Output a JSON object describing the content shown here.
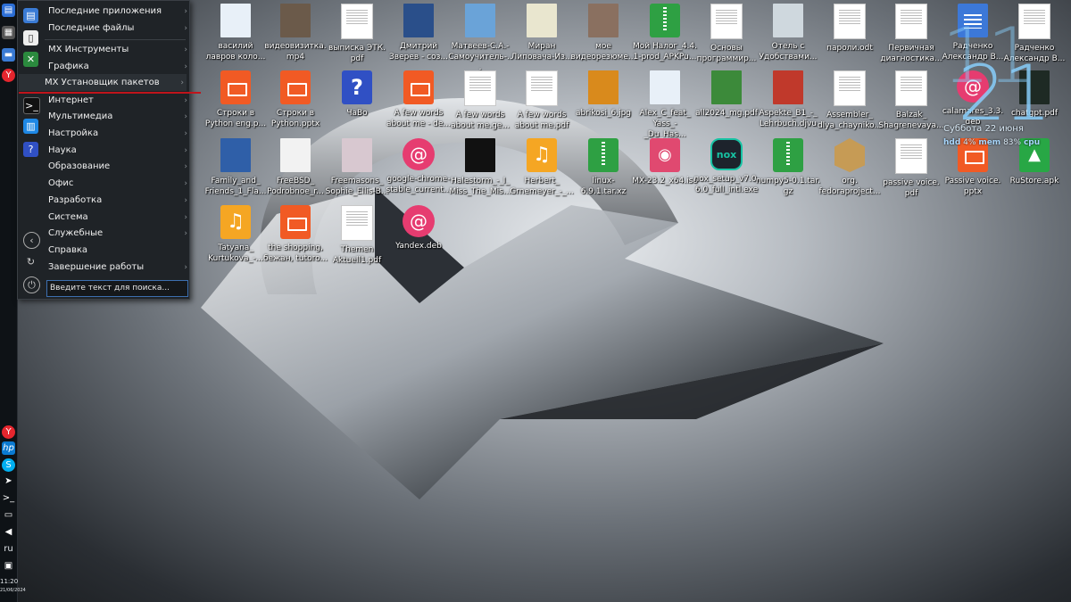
{
  "menu": {
    "items": [
      {
        "label": "Последние приложения",
        "icon": "recent-apps-icon"
      },
      {
        "label": "Последние файлы",
        "icon": "recent-files-icon"
      },
      {
        "label": "MX Инструменты",
        "icon": "mx-tools-icon"
      },
      {
        "label": "Графика",
        "icon": "graphics-icon"
      },
      {
        "label": "MX Установщик пакетов",
        "icon": "package-installer-icon"
      },
      {
        "label": "Интернет",
        "icon": "internet-icon"
      },
      {
        "label": "Мультимедиа",
        "icon": "multimedia-icon"
      },
      {
        "label": "Настройка",
        "icon": "settings-icon"
      },
      {
        "label": "Наука",
        "icon": "science-icon"
      },
      {
        "label": "Образование",
        "icon": "education-icon"
      },
      {
        "label": "Офис",
        "icon": "office-icon"
      },
      {
        "label": "Разработка",
        "icon": "development-icon"
      },
      {
        "label": "Система",
        "icon": "system-icon"
      },
      {
        "label": "Служебные",
        "icon": "utilities-icon"
      },
      {
        "label": "Справка",
        "icon": "help-icon"
      },
      {
        "label": "Завершение работы",
        "icon": "shutdown-icon"
      }
    ],
    "arrow": "›",
    "search_placeholder": "Введите текст для поиска..."
  },
  "taskbar": {
    "layout": "ru",
    "time": "11:20",
    "date": "21/06/2024"
  },
  "desktop": {
    "icons": [
      {
        "label": "василий лавров коло...",
        "kind": "pic",
        "color": "#e8f0f8"
      },
      {
        "label": "видеовизитка. mp4",
        "kind": "pic",
        "color": "#6b5a4a"
      },
      {
        "label": "выписка ЭТК. pdf",
        "kind": "doc"
      },
      {
        "label": "Дмитрий Зверев - соз...",
        "kind": "pic",
        "color": "#2a4f8a"
      },
      {
        "label": "Матвеев-С.А.- Самоучитель-...",
        "kind": "pic",
        "color": "#6aa3d8"
      },
      {
        "label": "Миран Липовача-Из...",
        "kind": "pic",
        "color": "#e9e6cf"
      },
      {
        "label": "мое видеорезюме...",
        "kind": "pic",
        "color": "#8a7060"
      },
      {
        "label": "Мой Налог_4.4. 1-prod_APKPu...",
        "kind": "zip"
      },
      {
        "label": "Основы программир...",
        "kind": "doc"
      },
      {
        "label": "Отель с Удобствами...",
        "kind": "pic",
        "color": "#cfd8de"
      },
      {
        "label": "пароли.odt",
        "kind": "doc"
      },
      {
        "label": "Первичная диагностика...",
        "kind": "doc"
      },
      {
        "label": "Радченко Александр В...",
        "kind": "gdoc"
      },
      {
        "label": "Радченко Александр В...",
        "kind": "doc"
      },
      {
        "label": "Строки в Python eng.p...",
        "kind": "pres"
      },
      {
        "label": "Строки в Python.pptx",
        "kind": "pres"
      },
      {
        "label": "ЧаВо",
        "kind": "question"
      },
      {
        "label": "A few words about me - de...",
        "kind": "pres"
      },
      {
        "label": "A few words about me.ge...",
        "kind": "doc"
      },
      {
        "label": "A few words about me.pdf",
        "kind": "doc"
      },
      {
        "label": "abrikosi_6.jpg",
        "kind": "pic",
        "color": "#d98a1c"
      },
      {
        "label": "Alex_C_feat_ Yass_-_Du_Has...",
        "kind": "pic",
        "color": "#e8f0f8"
      },
      {
        "label": "all2024_mg.pdf",
        "kind": "pic",
        "color": "#3c8a3a"
      },
      {
        "label": "Aspekte_B1_-_ Lehrbuch.djvu",
        "kind": "pic",
        "color": "#c0392b"
      },
      {
        "label": "Assembler_ dlya_chayniko...",
        "kind": "doc"
      },
      {
        "label": "Balzak_ Shagrenevaya...",
        "kind": "doc"
      },
      {
        "label": "calamares_3.3. deb",
        "kind": "debian"
      },
      {
        "label": "chatgpt.pdf",
        "kind": "pic",
        "color": "#1e2a24"
      },
      {
        "label": "Family_and_ Friends_1_Fla...",
        "kind": "pic",
        "color": "#2f5fa8"
      },
      {
        "label": "FreeBSD_ Podrobnoe_r...",
        "kind": "pic",
        "color": "#f2f2f2"
      },
      {
        "label": "Freemasons_ Sophie_Ellis-B...",
        "kind": "pic",
        "color": "#d8c8d0"
      },
      {
        "label": "google-chrome- stable_current...",
        "kind": "debian"
      },
      {
        "label": "Halestorm_-_I_ Miss_The_Mis...",
        "kind": "pic",
        "color": "#111111"
      },
      {
        "label": "Herbert_ Grnemeyer_-_...",
        "kind": "music"
      },
      {
        "label": "linux-6.9.1.tar.xz",
        "kind": "zip"
      },
      {
        "label": "MX-23.2_x64.iso",
        "kind": "disc"
      },
      {
        "label": "nox_setup_v7.0. 6.0_full_intl.exe",
        "kind": "nox"
      },
      {
        "label": "numpy5-0.1.tar. gz",
        "kind": "zip"
      },
      {
        "label": "org. fedoraproject...",
        "kind": "box"
      },
      {
        "label": "passive voice. pdf",
        "kind": "doc"
      },
      {
        "label": "Passive voice. pptx",
        "kind": "pres"
      },
      {
        "label": "RuStore.apk",
        "kind": "android"
      },
      {
        "label": "Tatyana_ Kurtukova_-...",
        "kind": "music"
      },
      {
        "label": "the shopping, бежан, tutoro...",
        "kind": "pres"
      },
      {
        "label": "Themen Aktuell1.pdf",
        "kind": "doc"
      },
      {
        "label": "Yandex.deb",
        "kind": "debian"
      }
    ]
  },
  "conky": {
    "time": "11",
    "day": "21",
    "date": "Суббота  22 июня",
    "hdd_label": "hdd",
    "hdd_value": "4%",
    "mem_label": "mem",
    "mem_value": "83%",
    "cpu_label": "cpu"
  },
  "colors": {
    "menu_bg": "#1f2327",
    "accent_red": "#c0141b",
    "search_border": "#3d6fb0",
    "conky_blue": "#87cefa"
  }
}
